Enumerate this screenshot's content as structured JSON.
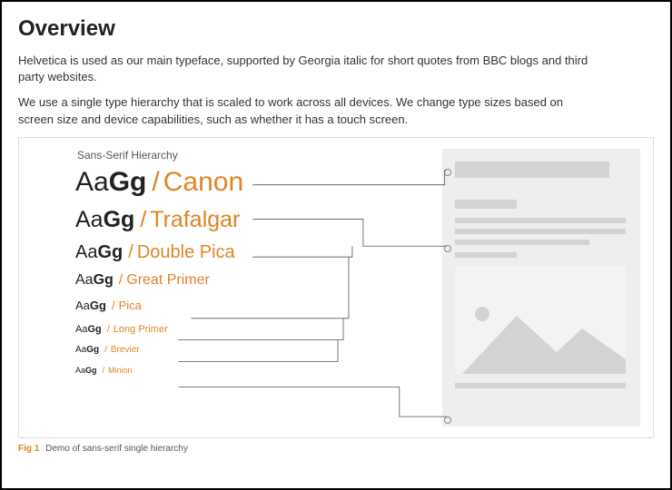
{
  "title": "Overview",
  "paragraphs": [
    "Helvetica is used as our main typeface, supported by Georgia italic for short quotes from BBC blogs and third party websites.",
    "We use a single type hierarchy that is scaled to work across all devices. We change type sizes based on screen size and device capabilities, such as whether it has a touch screen."
  ],
  "hierarchy_label": "Sans-Serif Hierarchy",
  "sample_prefix": "Aa",
  "sample_bold": "Gg",
  "slash": "/",
  "levels": [
    {
      "name": "Canon"
    },
    {
      "name": "Trafalgar"
    },
    {
      "name": "Double Pica"
    },
    {
      "name": "Great Primer"
    },
    {
      "name": "Pica"
    },
    {
      "name": "Long Primer"
    },
    {
      "name": "Brevier"
    },
    {
      "name": "Minion"
    }
  ],
  "caption": {
    "figno": "Fig 1",
    "text": "Demo of sans-serif single hierarchy"
  },
  "colors": {
    "accent": "#e08427"
  }
}
